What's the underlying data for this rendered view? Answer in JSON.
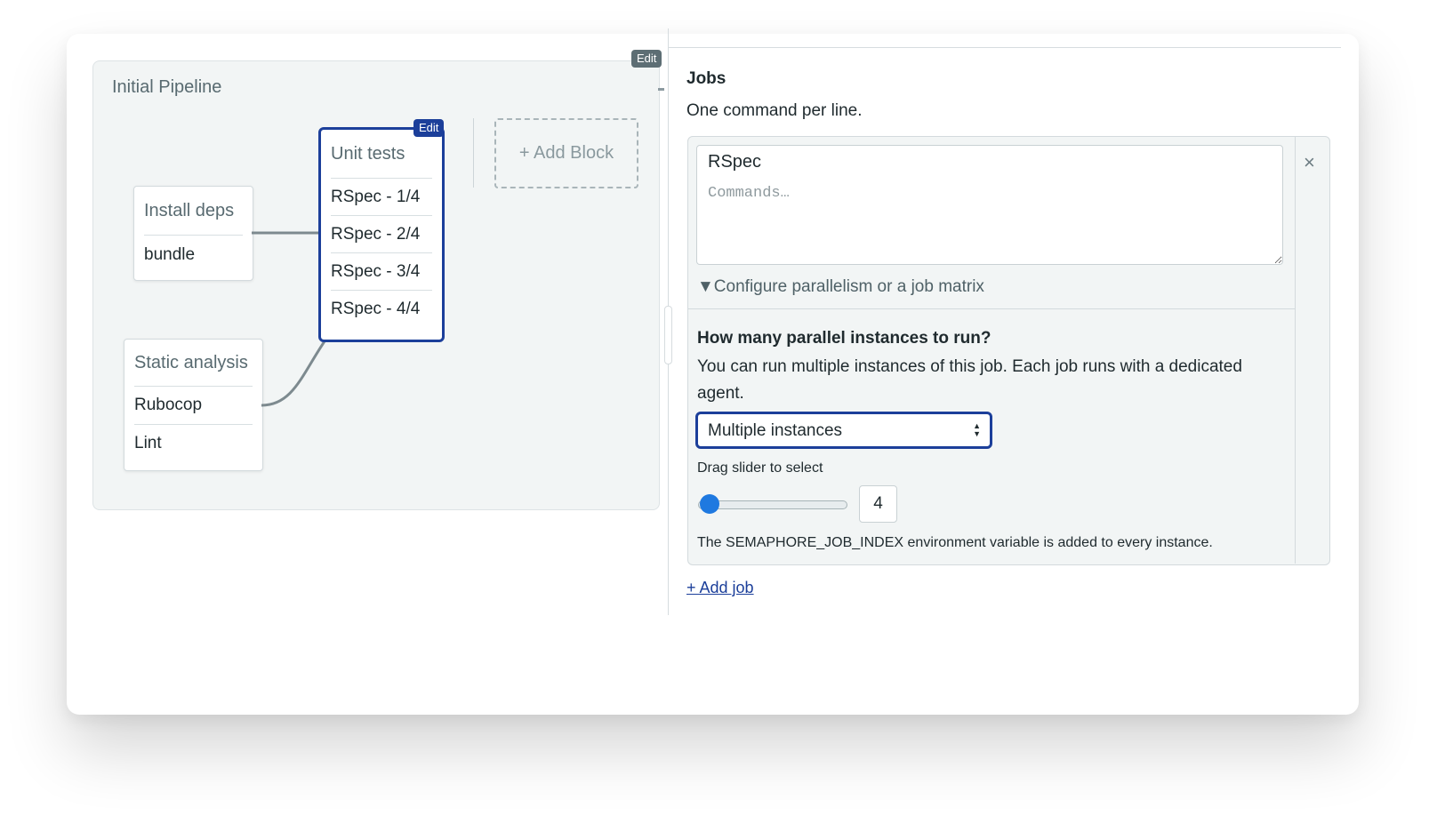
{
  "pipeline": {
    "title": "Initial Pipeline",
    "edit_label": "Edit",
    "add_block_label": "+ Add Block",
    "blocks": [
      {
        "title": "Install deps",
        "jobs": [
          "bundle"
        ]
      },
      {
        "title": "Static analysis",
        "jobs": [
          "Rubocop",
          "Lint"
        ]
      },
      {
        "title": "Unit tests",
        "edit_label": "Edit",
        "jobs": [
          "RSpec - 1/4",
          "RSpec - 2/4",
          "RSpec - 3/4",
          "RSpec - 4/4"
        ]
      }
    ]
  },
  "jobs_panel": {
    "title": "Jobs",
    "subtitle": "One command per line.",
    "job": {
      "name_value": "RSpec",
      "commands_placeholder": "Commands…",
      "close_icon": "×",
      "configure_label": "▼Configure parallelism or a job matrix",
      "parallel": {
        "question": "How many parallel instances to run?",
        "description": "You can run multiple instances of this job. Each job runs with a dedicated agent.",
        "select_value": "Multiple instances",
        "slider_label": "Drag slider to select",
        "instance_count": "4",
        "env_note": "The SEMAPHORE_JOB_INDEX environment variable is added to every instance."
      }
    },
    "add_job_label": "+ Add job"
  },
  "colors": {
    "accent": "#1c3f9a",
    "slider": "#1f79e0",
    "panel_bg": "#f2f5f5"
  }
}
